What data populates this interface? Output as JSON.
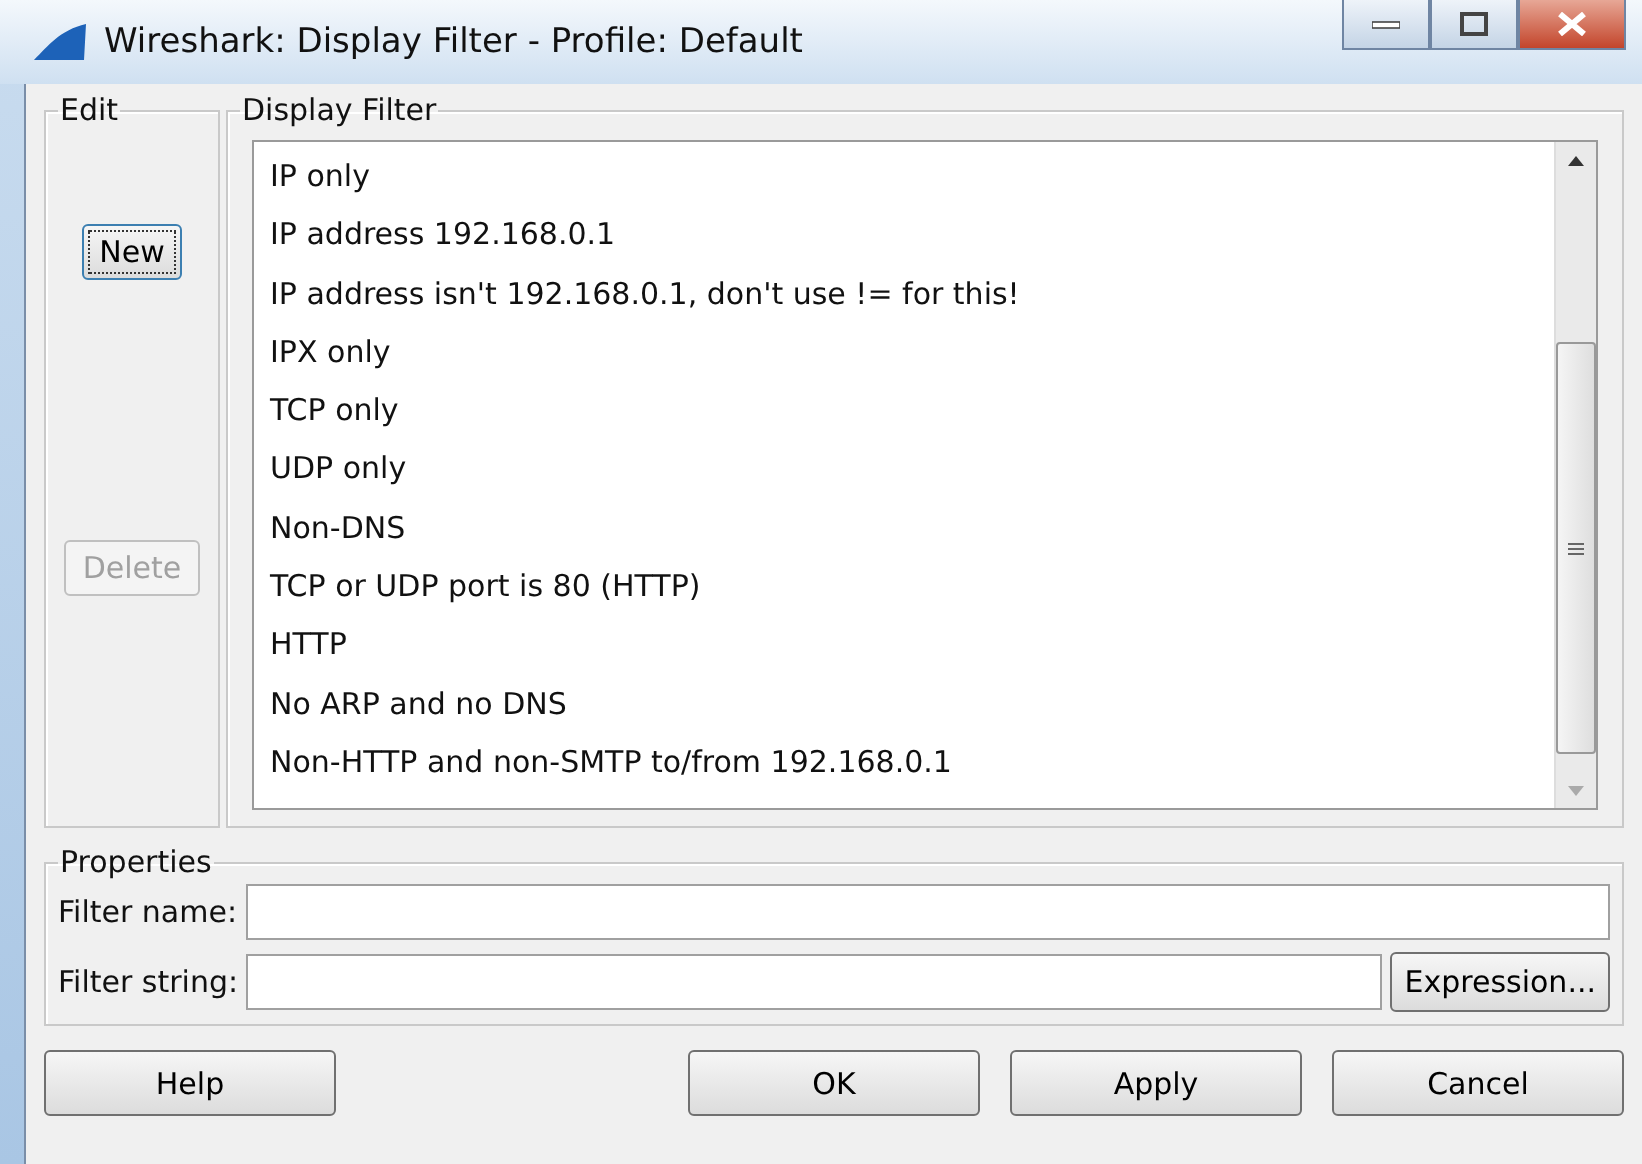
{
  "window": {
    "title": "Wireshark: Display Filter - Profile: Default"
  },
  "edit": {
    "label": "Edit",
    "buttons": [
      {
        "label": "New",
        "disabled": false,
        "focused": true
      },
      {
        "label": "Delete",
        "disabled": true,
        "focused": false
      }
    ]
  },
  "display_filter": {
    "label": "Display Filter",
    "items": [
      {
        "label": "IP only"
      },
      {
        "label": "IP address 192.168.0.1"
      },
      {
        "label": "IP address isn't 192.168.0.1, don't use != for this!"
      },
      {
        "label": "IPX only"
      },
      {
        "label": "TCP only"
      },
      {
        "label": "UDP only"
      },
      {
        "label": "Non-DNS"
      },
      {
        "label": "TCP or UDP port is 80 (HTTP)"
      },
      {
        "label": "HTTP"
      },
      {
        "label": "No ARP and no DNS"
      },
      {
        "label": "Non-HTTP and non-SMTP to/from 192.168.0.1"
      }
    ]
  },
  "properties": {
    "label": "Properties",
    "filter_name": {
      "label": "Filter name:"
    },
    "filter_string": {
      "label": "Filter string:"
    },
    "expression_button": "Expression..."
  },
  "buttons": [
    {
      "label": "Help"
    },
    {
      "label": "OK"
    },
    {
      "label": "Apply"
    },
    {
      "label": "Cancel"
    }
  ]
}
